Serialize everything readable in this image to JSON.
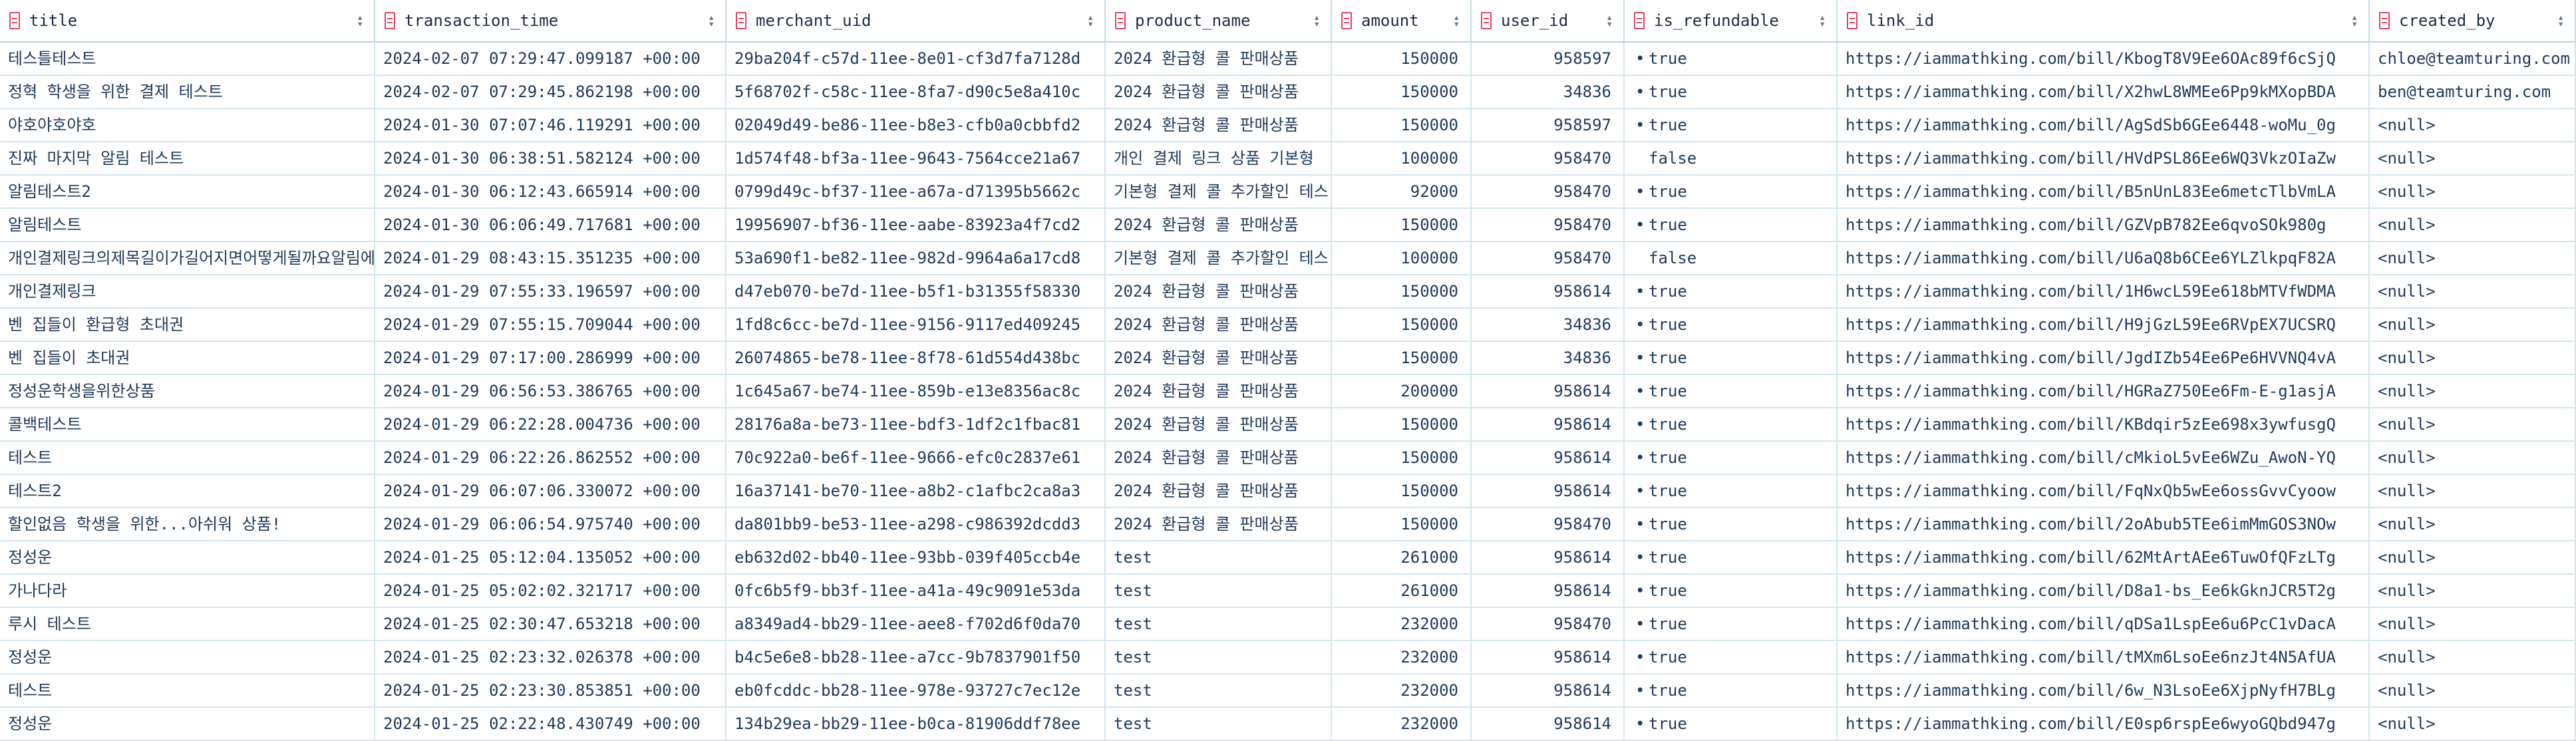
{
  "columns": [
    {
      "key": "title",
      "label": "title",
      "align": "left"
    },
    {
      "key": "transaction_time",
      "label": "transaction_time",
      "align": "left"
    },
    {
      "key": "merchant_uid",
      "label": "merchant_uid",
      "align": "left"
    },
    {
      "key": "product_name",
      "label": "product_name",
      "align": "left"
    },
    {
      "key": "amount",
      "label": "amount",
      "align": "right"
    },
    {
      "key": "user_id",
      "label": "user_id",
      "align": "right"
    },
    {
      "key": "is_refundable",
      "label": "is_refundable",
      "align": "left"
    },
    {
      "key": "link_id",
      "label": "link_id",
      "align": "left"
    },
    {
      "key": "created_by",
      "label": "created_by",
      "align": "left"
    }
  ],
  "rows": [
    {
      "title": "테스틀테스트",
      "transaction_time": "2024-02-07 07:29:47.099187 +00:00",
      "merchant_uid": "29ba204f-c57d-11ee-8e01-cf3d7fa7128d",
      "product_name": "2024 환급형 콜 판매상품",
      "amount": "150000",
      "user_id": "958597",
      "is_refundable": "true",
      "link_id": "https://iammathking.com/bill/KbogT8V9Ee6OAc89f6cSjQ",
      "created_by": "chloe@teamturing.com"
    },
    {
      "title": "정혁 학생을 위한 결제 테스트",
      "transaction_time": "2024-02-07 07:29:45.862198 +00:00",
      "merchant_uid": "5f68702f-c58c-11ee-8fa7-d90c5e8a410c",
      "product_name": "2024 환급형 콜 판매상품",
      "amount": "150000",
      "user_id": "34836",
      "is_refundable": "true",
      "link_id": "https://iammathking.com/bill/X2hwL8WMEe6Pp9kMXopBDA",
      "created_by": "ben@teamturing.com"
    },
    {
      "title": "야호야호야호",
      "transaction_time": "2024-01-30 07:07:46.119291 +00:00",
      "merchant_uid": "02049d49-be86-11ee-b8e3-cfb0a0cbbfd2",
      "product_name": "2024 환급형 콜 판매상품",
      "amount": "150000",
      "user_id": "958597",
      "is_refundable": "true",
      "link_id": "https://iammathking.com/bill/AgSdSb6GEe6448-woMu_0g",
      "created_by": "<null>"
    },
    {
      "title": "진짜 마지막 알림 테스트",
      "transaction_time": "2024-01-30 06:38:51.582124 +00:00",
      "merchant_uid": "1d574f48-bf3a-11ee-9643-7564cce21a67",
      "product_name": "개인 결제 링크 상품 기본형",
      "amount": "100000",
      "user_id": "958470",
      "is_refundable": "false",
      "link_id": "https://iammathking.com/bill/HVdPSL86Ee6WQ3VkzOIaZw",
      "created_by": "<null>"
    },
    {
      "title": "알림테스트2",
      "transaction_time": "2024-01-30 06:12:43.665914 +00:00",
      "merchant_uid": "0799d49c-bf37-11ee-a67a-d71395b5662c",
      "product_name": "기본형 결제 콜 추가할인 테스",
      "amount": "92000",
      "user_id": "958470",
      "is_refundable": "true",
      "link_id": "https://iammathking.com/bill/B5nUnL83Ee6metcTlbVmLA",
      "created_by": "<null>"
    },
    {
      "title": "알림테스트",
      "transaction_time": "2024-01-30 06:06:49.717681 +00:00",
      "merchant_uid": "19956907-bf36-11ee-aabe-83923a4f7cd2",
      "product_name": "2024 환급형 콜 판매상품",
      "amount": "150000",
      "user_id": "958470",
      "is_refundable": "true",
      "link_id": "https://iammathking.com/bill/GZVpB782Ee6qvoSOk980g",
      "created_by": "<null>"
    },
    {
      "title": "개인결제링크의제목길이가길어지면어떻게될까요알림에선어",
      "transaction_time": "2024-01-29 08:43:15.351235 +00:00",
      "merchant_uid": "53a690f1-be82-11ee-982d-9964a6a17cd8",
      "product_name": "기본형 결제 콜 추가할인 테스",
      "amount": "100000",
      "user_id": "958470",
      "is_refundable": "false",
      "link_id": "https://iammathking.com/bill/U6aQ8b6CEe6YLZlkpqF82A",
      "created_by": "<null>"
    },
    {
      "title": "개인결제링크",
      "transaction_time": "2024-01-29 07:55:33.196597 +00:00",
      "merchant_uid": "d47eb070-be7d-11ee-b5f1-b31355f58330",
      "product_name": "2024 환급형 콜 판매상품",
      "amount": "150000",
      "user_id": "958614",
      "is_refundable": "true",
      "link_id": "https://iammathking.com/bill/1H6wcL59Ee618bMTVfWDMA",
      "created_by": "<null>"
    },
    {
      "title": "벤 집들이 환급형 초대권",
      "transaction_time": "2024-01-29 07:55:15.709044 +00:00",
      "merchant_uid": "1fd8c6cc-be7d-11ee-9156-9117ed409245",
      "product_name": "2024 환급형 콜 판매상품",
      "amount": "150000",
      "user_id": "34836",
      "is_refundable": "true",
      "link_id": "https://iammathking.com/bill/H9jGzL59Ee6RVpEX7UCSRQ",
      "created_by": "<null>"
    },
    {
      "title": "벤 집들이 초대권",
      "transaction_time": "2024-01-29 07:17:00.286999 +00:00",
      "merchant_uid": "26074865-be78-11ee-8f78-61d554d438bc",
      "product_name": "2024 환급형 콜 판매상품",
      "amount": "150000",
      "user_id": "34836",
      "is_refundable": "true",
      "link_id": "https://iammathking.com/bill/JgdIZb54Ee6Pe6HVVNQ4vA",
      "created_by": "<null>"
    },
    {
      "title": "정성운학생을위한상품",
      "transaction_time": "2024-01-29 06:56:53.386765 +00:00",
      "merchant_uid": "1c645a67-be74-11ee-859b-e13e8356ac8c",
      "product_name": "2024 환급형 콜 판매상품",
      "amount": "200000",
      "user_id": "958614",
      "is_refundable": "true",
      "link_id": "https://iammathking.com/bill/HGRaZ750Ee6Fm-E-g1asjA",
      "created_by": "<null>"
    },
    {
      "title": "콜백테스트",
      "transaction_time": "2024-01-29 06:22:28.004736 +00:00",
      "merchant_uid": "28176a8a-be73-11ee-bdf3-1df2c1fbac81",
      "product_name": "2024 환급형 콜 판매상품",
      "amount": "150000",
      "user_id": "958614",
      "is_refundable": "true",
      "link_id": "https://iammathking.com/bill/KBdqir5zEe698x3ywfusgQ",
      "created_by": "<null>"
    },
    {
      "title": "테스트",
      "transaction_time": "2024-01-29 06:22:26.862552 +00:00",
      "merchant_uid": "70c922a0-be6f-11ee-9666-efc0c2837e61",
      "product_name": "2024 환급형 콜 판매상품",
      "amount": "150000",
      "user_id": "958614",
      "is_refundable": "true",
      "link_id": "https://iammathking.com/bill/cMkioL5vEe6WZu_AwoN-YQ",
      "created_by": "<null>"
    },
    {
      "title": "테스트2",
      "transaction_time": "2024-01-29 06:07:06.330072 +00:00",
      "merchant_uid": "16a37141-be70-11ee-a8b2-c1afbc2ca8a3",
      "product_name": "2024 환급형 콜 판매상품",
      "amount": "150000",
      "user_id": "958614",
      "is_refundable": "true",
      "link_id": "https://iammathking.com/bill/FqNxQb5wEe6ossGvvCyoow",
      "created_by": "<null>"
    },
    {
      "title": "할인없음 학생을 위한...아쉬워 상품!",
      "transaction_time": "2024-01-29 06:06:54.975740 +00:00",
      "merchant_uid": "da801bb9-be53-11ee-a298-c986392dcdd3",
      "product_name": "2024 환급형 콜 판매상품",
      "amount": "150000",
      "user_id": "958470",
      "is_refundable": "true",
      "link_id": "https://iammathking.com/bill/2oAbub5TEe6imMmGOS3NOw",
      "created_by": "<null>"
    },
    {
      "title": "정성운",
      "transaction_time": "2024-01-25 05:12:04.135052 +00:00",
      "merchant_uid": "eb632d02-bb40-11ee-93bb-039f405ccb4e",
      "product_name": "test",
      "amount": "261000",
      "user_id": "958614",
      "is_refundable": "true",
      "link_id": "https://iammathking.com/bill/62MtArtAEe6TuwOfQFzLTg",
      "created_by": "<null>"
    },
    {
      "title": "가나다라",
      "transaction_time": "2024-01-25 05:02:02.321717 +00:00",
      "merchant_uid": "0fc6b5f9-bb3f-11ee-a41a-49c9091e53da",
      "product_name": "test",
      "amount": "261000",
      "user_id": "958614",
      "is_refundable": "true",
      "link_id": "https://iammathking.com/bill/D8a1-bs_Ee6kGknJCR5T2g",
      "created_by": "<null>"
    },
    {
      "title": "루시 테스트",
      "transaction_time": "2024-01-25 02:30:47.653218 +00:00",
      "merchant_uid": "a8349ad4-bb29-11ee-aee8-f702d6f0da70",
      "product_name": "test",
      "amount": "232000",
      "user_id": "958470",
      "is_refundable": "true",
      "link_id": "https://iammathking.com/bill/qDSa1LspEe6u6PcC1vDacA",
      "created_by": "<null>"
    },
    {
      "title": "정성운",
      "transaction_time": "2024-01-25 02:23:32.026378 +00:00",
      "merchant_uid": "b4c5e6e8-bb28-11ee-a7cc-9b7837901f50",
      "product_name": "test",
      "amount": "232000",
      "user_id": "958614",
      "is_refundable": "true",
      "link_id": "https://iammathking.com/bill/tMXm6LsoEe6nzJt4N5AfUA",
      "created_by": "<null>"
    },
    {
      "title": "테스트",
      "transaction_time": "2024-01-25 02:23:30.853851 +00:00",
      "merchant_uid": "eb0fcddc-bb28-11ee-978e-93727c7ec12e",
      "product_name": "test",
      "amount": "232000",
      "user_id": "958614",
      "is_refundable": "true",
      "link_id": "https://iammathking.com/bill/6w_N3LsoEe6XjpNyfH7BLg",
      "created_by": "<null>"
    },
    {
      "title": "정성운",
      "transaction_time": "2024-01-25 02:22:48.430749 +00:00",
      "merchant_uid": "134b29ea-bb29-11ee-b0ca-81906ddf78ee",
      "product_name": "test",
      "amount": "232000",
      "user_id": "958614",
      "is_refundable": "true",
      "link_id": "https://iammathking.com/bill/E0sp6rspEe6wyoGQbd947g",
      "created_by": "<null>"
    }
  ]
}
